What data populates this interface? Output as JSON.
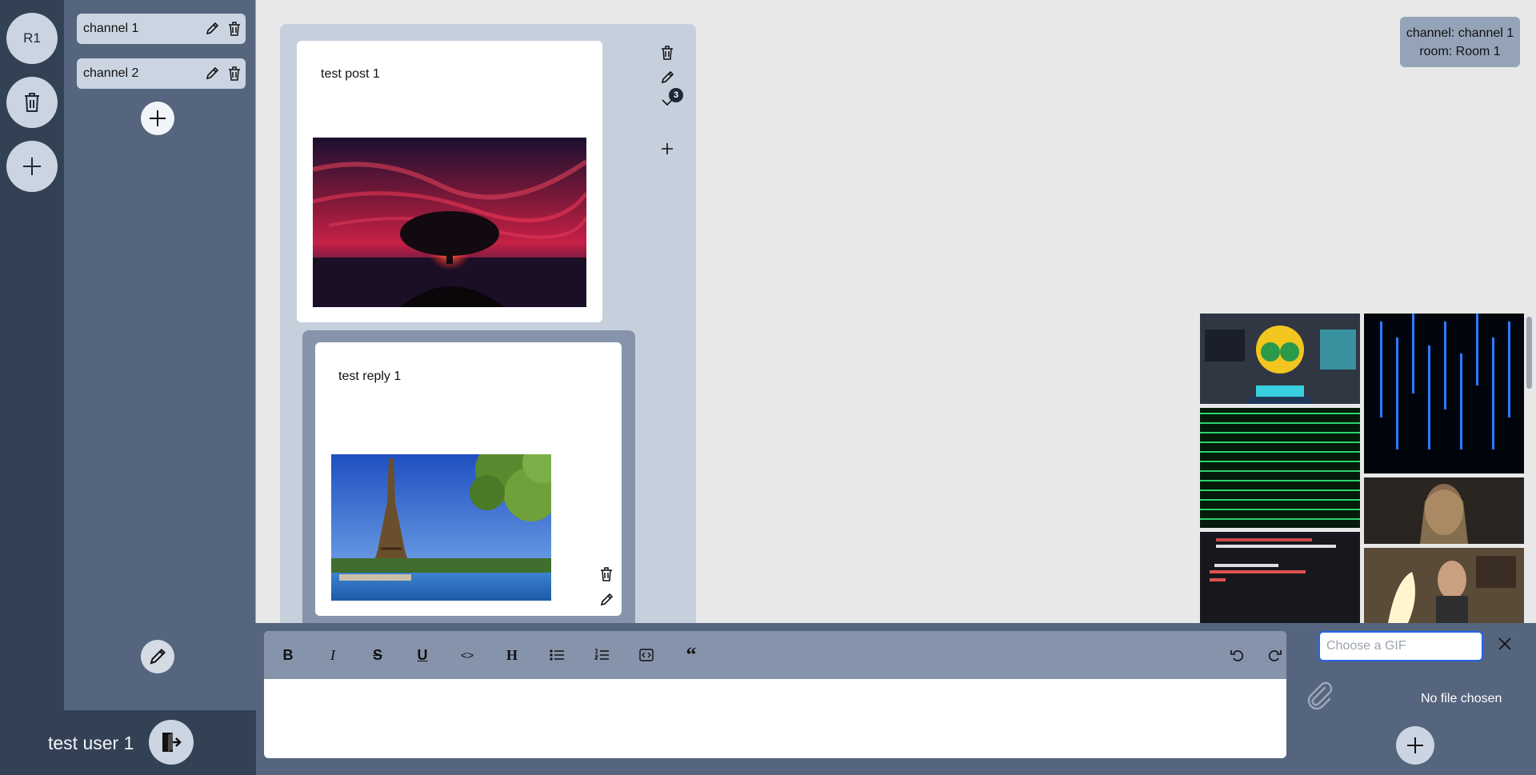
{
  "rooms": {
    "items": [
      {
        "label": "R1"
      }
    ]
  },
  "channels": {
    "items": [
      {
        "label": "channel 1"
      },
      {
        "label": "channel 2"
      }
    ]
  },
  "user": {
    "name": "test user 1"
  },
  "thread": {
    "post": {
      "text": "test post 1"
    },
    "reply": {
      "text": "test reply 1"
    },
    "reply_count": "3"
  },
  "info": {
    "channel": "channel: channel 1",
    "room": "room: Room 1"
  },
  "composer": {
    "gif_placeholder": "Choose a GIF",
    "no_file": "No file chosen",
    "tools": [
      "bold-icon",
      "italic-icon",
      "strikethrough-icon",
      "underline-icon",
      "code-icon",
      "heading-icon",
      "bullet-list-icon",
      "ordered-list-icon",
      "code-block-icon",
      "quote-icon"
    ]
  },
  "gifs": {
    "count": 6,
    "items": [
      "robot-hacker-gif",
      "matrix-blue-gif",
      "matrix-green-gif",
      "woman-gif",
      "code-screen-gif",
      "fire-man-gif"
    ]
  },
  "colors": {
    "rail": "#334155",
    "channel_panel": "#56657e",
    "thread_bg": "#c5d0dc",
    "reply_bg": "#8593ab",
    "accent_input": "#2563eb"
  }
}
